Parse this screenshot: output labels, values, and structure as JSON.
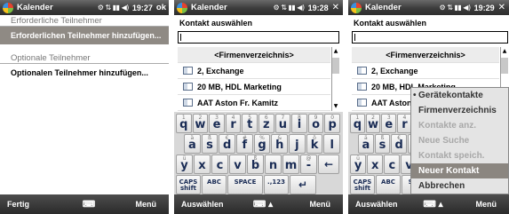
{
  "screens": [
    {
      "title": "Kalender",
      "time": "19:27",
      "corner": "ok",
      "sections": [
        {
          "heading": "Erforderliche Teilnehmer",
          "action": "Erforderlichen Teilnehmer hinzufügen..."
        },
        {
          "heading": "Optionale Teilnehmer",
          "action": "Optionalen Teilnehmer hinzufügen..."
        }
      ],
      "softkeys": {
        "left": "Fertig",
        "middle": "keyboard-icon",
        "right": "Menü"
      }
    },
    {
      "title": "Kalender",
      "time": "19:28",
      "corner": "✕",
      "label": "Kontakt auswählen",
      "input_value": "",
      "list": [
        "<Firmenverzeichnis>",
        "2, Exchange",
        "20 MB, HDL Marketing",
        "AAT Aston Fr. Kamitz"
      ],
      "softkeys": {
        "left": "Auswählen",
        "middle": "keyboard-icon",
        "right": "Menü"
      }
    },
    {
      "title": "Kalender",
      "time": "19:29",
      "corner": "✕",
      "label": "Kontakt auswählen",
      "input_value": "",
      "list": [
        "<Firmenverzeichnis>",
        "2, Exchange",
        "20 MB, HDL Marketing",
        "AAT Aston Fr. Kamitz"
      ],
      "softkeys": {
        "left": "Auswählen",
        "middle": "keyboard-icon",
        "right": "Menü"
      },
      "menu": [
        {
          "label": "Gerätekontakte",
          "state": "checked"
        },
        {
          "label": "Firmenverzeichnis",
          "state": "enabled"
        },
        {
          "label": "Kontakte anz.",
          "state": "disabled"
        },
        {
          "label": "Neue Suche",
          "state": "disabled"
        },
        {
          "label": "Kontakt speich.",
          "state": "disabled"
        },
        {
          "label": "Neuer Kontakt",
          "state": "highlighted"
        },
        {
          "label": "Abbrechen",
          "state": "enabled"
        }
      ]
    }
  ],
  "keyboard": {
    "rows": [
      [
        {
          "sym": "1",
          "ch": "q"
        },
        {
          "sym": "2",
          "ch": "w"
        },
        {
          "sym": "3",
          "ch": "e"
        },
        {
          "sym": "4",
          "ch": "r"
        },
        {
          "sym": "5",
          "ch": "t"
        },
        {
          "sym": "6",
          "ch": "z"
        },
        {
          "sym": "7",
          "ch": "u"
        },
        {
          "sym": "8",
          "ch": "i"
        },
        {
          "sym": "9",
          "ch": "o"
        },
        {
          "sym": "0",
          "ch": "p"
        }
      ],
      [
        {
          "sym": "ä",
          "ch": "a"
        },
        {
          "sym": "ß",
          "ch": "s"
        },
        {
          "sym": "€",
          "ch": "d"
        },
        {
          "sym": "#",
          "ch": "f"
        },
        {
          "sym": "%",
          "ch": "g"
        },
        {
          "sym": "&",
          "ch": "h"
        },
        {
          "sym": "",
          "ch": "j"
        },
        {
          "sym": "ö",
          "ch": "k"
        },
        {
          "sym": "",
          "ch": "l"
        }
      ],
      [
        {
          "sym": "ü",
          "ch": "y"
        },
        {
          "sym": "",
          "ch": "x"
        },
        {
          "sym": "",
          "ch": "c"
        },
        {
          "sym": "",
          "ch": "v"
        },
        {
          "sym": "ß",
          "ch": "b"
        },
        {
          "sym": "",
          "ch": "n"
        },
        {
          "sym": "",
          "ch": "m"
        },
        {
          "sym": "@",
          "ch": "-"
        }
      ],
      [
        {
          "txt": "CAPS shift"
        },
        {
          "txt": "ABC"
        },
        {
          "txt": "SPACE"
        },
        {
          "txt": ".,123"
        }
      ]
    ],
    "backspace": "←",
    "enter": "↵"
  }
}
